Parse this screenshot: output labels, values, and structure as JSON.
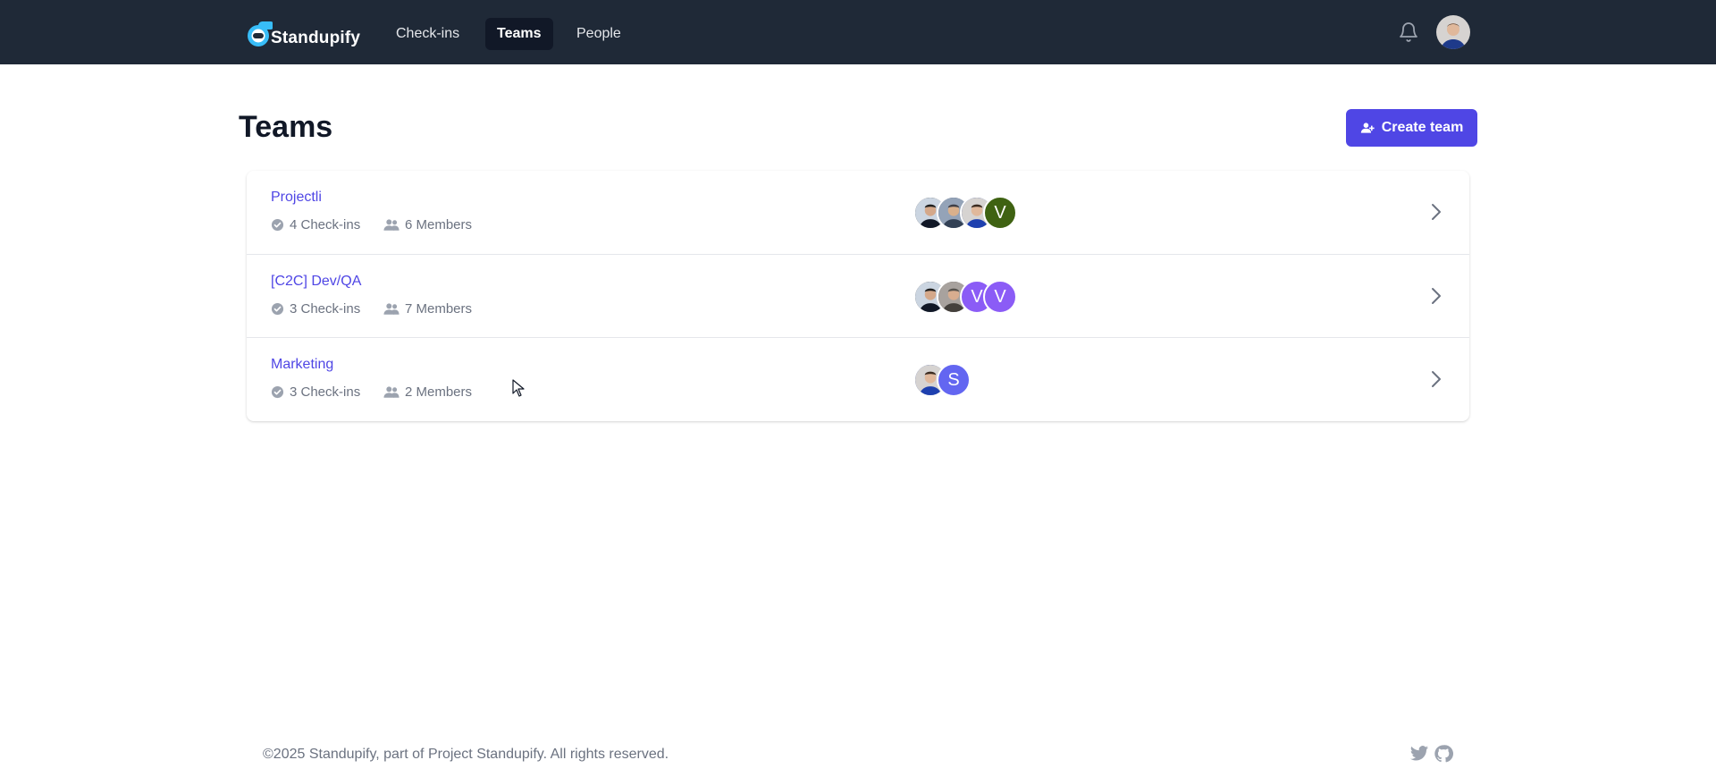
{
  "app": {
    "name": "Standupify"
  },
  "nav": {
    "links": [
      {
        "label": "Check-ins",
        "active": false
      },
      {
        "label": "Teams",
        "active": true
      },
      {
        "label": "People",
        "active": false
      }
    ],
    "icons": {
      "notifications": "bell-icon",
      "user": "avatar"
    }
  },
  "page": {
    "title": "Teams",
    "create_button": "Create team"
  },
  "teams": [
    {
      "name": "Projectli",
      "checkins": "4 Check-ins",
      "members": "6 Members",
      "avatars": [
        {
          "type": "photo",
          "tone": "#2d2d2d"
        },
        {
          "type": "photo",
          "tone": "#3b4a63"
        },
        {
          "type": "photo",
          "tone": "#1e3a8a"
        },
        {
          "type": "letter",
          "letter": "V",
          "color": "#3f6212"
        }
      ]
    },
    {
      "name": "[C2C] Dev/QA",
      "checkins": "3 Check-ins",
      "members": "7 Members",
      "avatars": [
        {
          "type": "photo",
          "tone": "#2d2d2d"
        },
        {
          "type": "photo",
          "tone": "#4b3f36"
        },
        {
          "type": "letter",
          "letter": "V",
          "color": "#8b5cf6"
        },
        {
          "type": "letter",
          "letter": "V",
          "color": "#8b5cf6"
        }
      ]
    },
    {
      "name": "Marketing",
      "checkins": "3 Check-ins",
      "members": "2 Members",
      "avatars": [
        {
          "type": "photo",
          "tone": "#1e3a8a"
        },
        {
          "type": "letter",
          "letter": "S",
          "color": "#6366f1"
        }
      ]
    }
  ],
  "footer": {
    "copyright": "©2025 Standupify, part of Project Standupify. All rights reserved.",
    "icons": [
      "twitter-icon",
      "github-icon"
    ]
  },
  "colors": {
    "navbar": "#1f2937",
    "accent": "#4f46e5",
    "muted": "#6b7280"
  }
}
